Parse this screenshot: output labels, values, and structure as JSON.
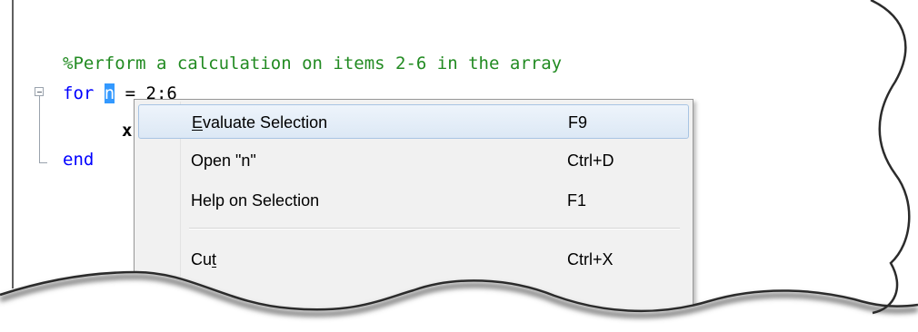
{
  "editor": {
    "comment": "%Perform a calculation on items 2-6 in the array",
    "line2": {
      "keyword": "for",
      "selected_var": "n",
      "rest": " = 2:6"
    },
    "line3": {
      "text": "x"
    },
    "line4": {
      "keyword": "end"
    }
  },
  "context_menu": {
    "items": [
      {
        "label_mnemonic": "E",
        "label_rest": "valuate Selection",
        "shortcut": "F9"
      },
      {
        "label": "Open \"n\"",
        "shortcut": "Ctrl+D"
      },
      {
        "label": "Help on Selection",
        "shortcut": "F1"
      },
      {
        "label_pre": "Cu",
        "label_mnemonic": "t",
        "label_rest": "",
        "shortcut": "Ctrl+X"
      }
    ]
  },
  "colors": {
    "comment": "#228b22",
    "keyword": "#0000ff",
    "selection": "#3399ff",
    "menu_highlight": "#dce8f5"
  }
}
